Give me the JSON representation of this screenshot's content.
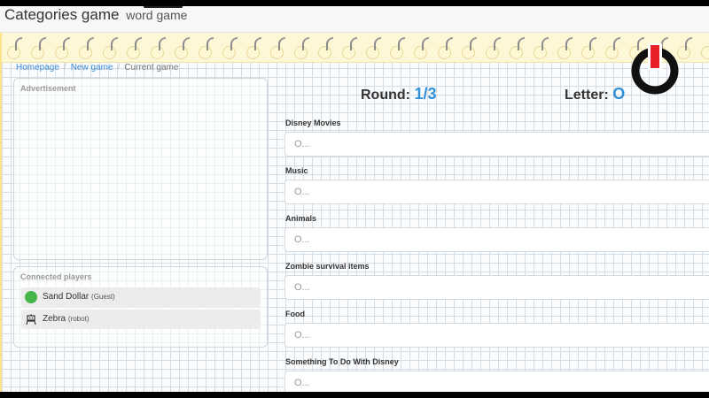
{
  "header": {
    "title": "Categories game",
    "subtitle": "word game"
  },
  "breadcrumb": {
    "home": "Homepage",
    "new_game": "New game",
    "current": "Current game"
  },
  "ad": {
    "label": "Advertisement"
  },
  "players": {
    "label": "Connected players",
    "items": [
      {
        "name": "Sand Dollar",
        "role": "(Guest)",
        "icon": "online-dot-icon"
      },
      {
        "name": "Zebra",
        "role": "(robot)",
        "icon": "robot-icon"
      }
    ]
  },
  "game": {
    "round_label": "Round:",
    "round_value": "1/3",
    "letter_label": "Letter:",
    "letter_value": "O"
  },
  "categories": [
    {
      "label": "Disney Movies",
      "placeholder": "O..."
    },
    {
      "label": "Music",
      "placeholder": "O..."
    },
    {
      "label": "Animals",
      "placeholder": "O..."
    },
    {
      "label": "Zombie survival items",
      "placeholder": "O..."
    },
    {
      "label": "Food",
      "placeholder": "O..."
    },
    {
      "label": "Something To Do With Disney",
      "placeholder": "O..."
    }
  ],
  "colors": {
    "accent": "#2f90d9",
    "paper_top": "#fdf7d6",
    "logo_red": "#e8202a"
  }
}
